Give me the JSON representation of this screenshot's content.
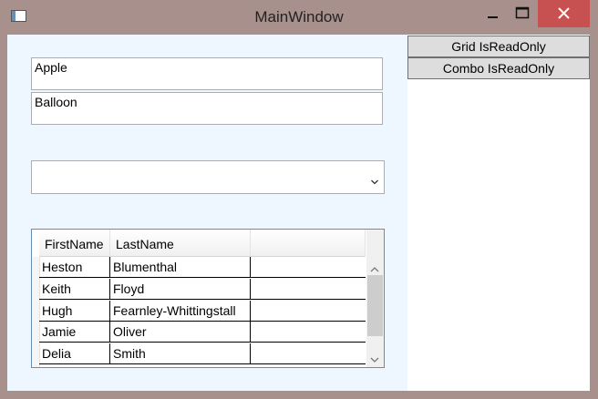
{
  "window": {
    "title": "MainWindow"
  },
  "textboxes": {
    "first": "Apple",
    "second": "Balloon"
  },
  "combo": {
    "value": ""
  },
  "grid": {
    "columns": [
      "FirstName",
      "LastName",
      ""
    ],
    "rows": [
      [
        "Heston",
        "Blumenthal",
        ""
      ],
      [
        "Keith",
        "Floyd",
        ""
      ],
      [
        "Hugh",
        "Fearnley-Whittingstall",
        ""
      ],
      [
        "Jamie",
        "Oliver",
        ""
      ],
      [
        "Delia",
        "Smith",
        ""
      ]
    ]
  },
  "buttons": {
    "grid_readonly": "Grid IsReadOnly",
    "combo_readonly": "Combo IsReadOnly"
  },
  "colors": {
    "close": "#c75050",
    "frame": "#a8908c",
    "pane": "#eef6ff"
  }
}
